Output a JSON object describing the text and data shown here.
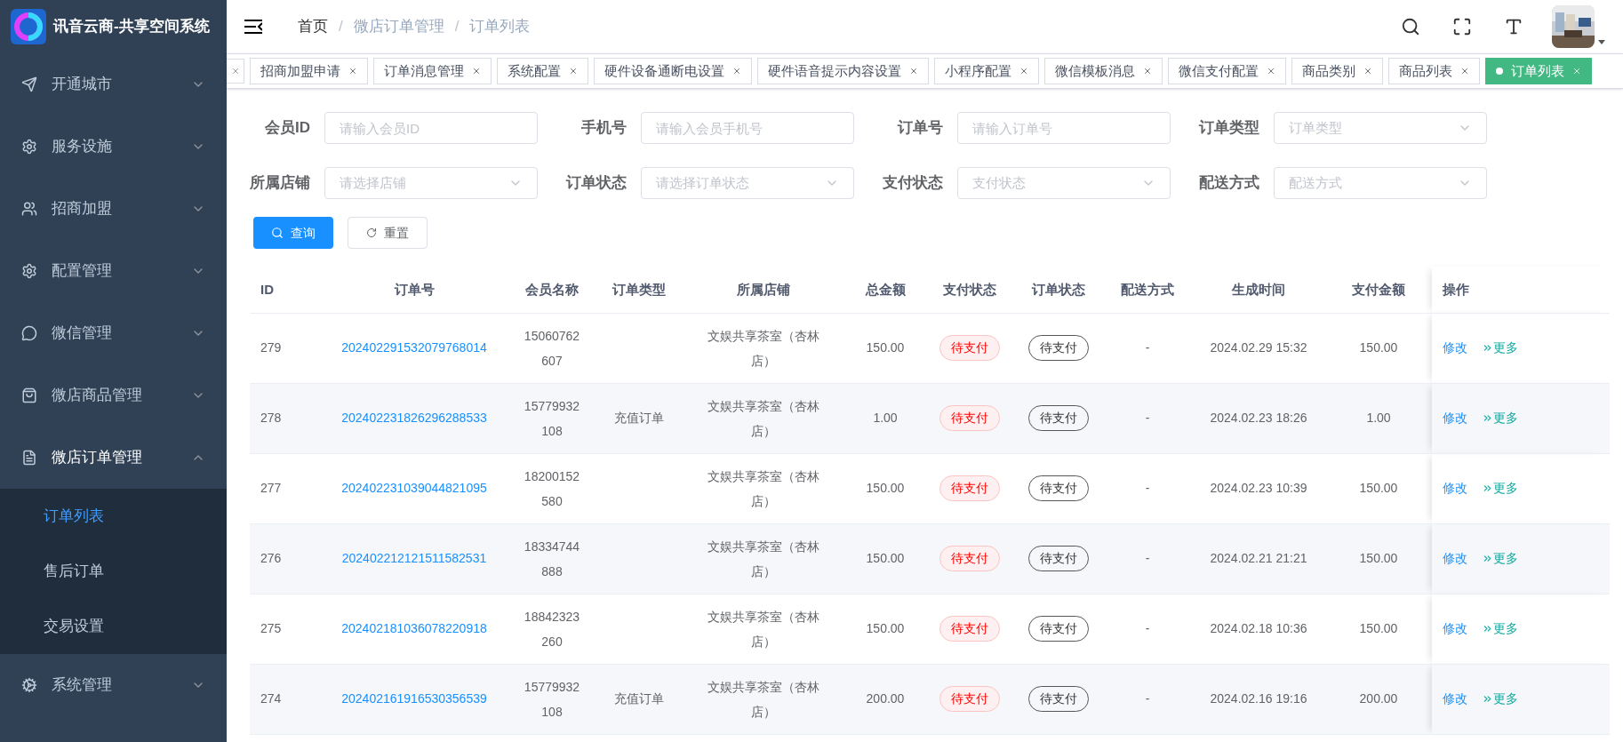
{
  "logo": {
    "title": "讯音云商-共享空间系统"
  },
  "sidebar": {
    "items": [
      {
        "label": "开通城市",
        "expanded": false
      },
      {
        "label": "服务设施",
        "expanded": false
      },
      {
        "label": "招商加盟",
        "expanded": false
      },
      {
        "label": "配置管理",
        "expanded": false
      },
      {
        "label": "微信管理",
        "expanded": false
      },
      {
        "label": "微店商品管理",
        "expanded": false
      },
      {
        "label": "微店订单管理",
        "expanded": true,
        "children": [
          {
            "label": "订单列表",
            "selected": true
          },
          {
            "label": "售后订单",
            "selected": false
          },
          {
            "label": "交易设置",
            "selected": false
          }
        ]
      },
      {
        "label": "系统管理",
        "expanded": false
      }
    ]
  },
  "breadcrumb": {
    "separator": "/",
    "items": [
      "首页",
      "微店订单管理",
      "订单列表"
    ]
  },
  "tabs": [
    {
      "kind": "clipped"
    },
    {
      "kind": "tab",
      "label": "招商加盟申请",
      "selected": false
    },
    {
      "kind": "tab",
      "label": "订单消息管理",
      "selected": false
    },
    {
      "kind": "tab",
      "label": "系统配置",
      "selected": false
    },
    {
      "kind": "tab",
      "label": "硬件设备通断电设置",
      "selected": false
    },
    {
      "kind": "tab",
      "label": "硬件语音提示内容设置",
      "selected": false
    },
    {
      "kind": "tab",
      "label": "小程序配置",
      "selected": false
    },
    {
      "kind": "tab",
      "label": "微信模板消息",
      "selected": false
    },
    {
      "kind": "tab",
      "label": "微信支付配置",
      "selected": false
    },
    {
      "kind": "tab",
      "label": "商品类别",
      "selected": false
    },
    {
      "kind": "tab",
      "label": "商品列表",
      "selected": false
    },
    {
      "kind": "tab",
      "label": "订单列表",
      "selected": true
    }
  ],
  "filters": [
    {
      "label": "会员ID",
      "kind": "input",
      "placeholder": "请输入会员ID"
    },
    {
      "label": "手机号",
      "kind": "input",
      "placeholder": "请输入会员手机号"
    },
    {
      "label": "订单号",
      "kind": "input",
      "placeholder": "请输入订单号"
    },
    {
      "label": "订单类型",
      "kind": "select",
      "placeholder": "订单类型"
    },
    {
      "label": "所属店铺",
      "kind": "select",
      "placeholder": "请选择店铺"
    },
    {
      "label": "订单状态",
      "kind": "select",
      "placeholder": "请选择订单状态"
    },
    {
      "label": "支付状态",
      "kind": "select",
      "placeholder": "支付状态"
    },
    {
      "label": "配送方式",
      "kind": "select",
      "placeholder": "配送方式"
    }
  ],
  "buttons": {
    "search": "查询",
    "reset": "重置"
  },
  "table": {
    "columns": [
      "ID",
      "订单号",
      "会员名称",
      "订单类型",
      "所属店铺",
      "总金额",
      "支付状态",
      "订单状态",
      "配送方式",
      "生成时间",
      "支付金额",
      "操作"
    ],
    "rows": [
      {
        "id": "279",
        "order_no": "202402291532079768014",
        "member": "15060762607",
        "store": "文娱共享茶室（杏林店）",
        "total": "150.00",
        "pay_status": "待支付",
        "order_status": "待支付",
        "delivery": "-",
        "time": "2024.02.29 15:32",
        "paid": "150.00",
        "edit": "修改",
        "more": "更多"
      },
      {
        "id": "278",
        "order_no": "202402231826296288533",
        "member": "15779932108",
        "type": "充值订单",
        "store": "文娱共享茶室（杏林店）",
        "total": "1.00",
        "pay_status": "待支付",
        "order_status": "待支付",
        "delivery": "-",
        "time": "2024.02.23 18:26",
        "paid": "1.00",
        "edit": "修改",
        "more": "更多"
      },
      {
        "id": "277",
        "order_no": "202402231039044821095",
        "member": "18200152580",
        "store": "文娱共享茶室（杏林店）",
        "total": "150.00",
        "pay_status": "待支付",
        "order_status": "待支付",
        "delivery": "-",
        "time": "2024.02.23 10:39",
        "paid": "150.00",
        "edit": "修改",
        "more": "更多"
      },
      {
        "id": "276",
        "order_no": "202402212121511582531",
        "member": "18334744888",
        "store": "文娱共享茶室（杏林店）",
        "total": "150.00",
        "pay_status": "待支付",
        "order_status": "待支付",
        "delivery": "-",
        "time": "2024.02.21 21:21",
        "paid": "150.00",
        "edit": "修改",
        "more": "更多"
      },
      {
        "id": "275",
        "order_no": "202402181036078220918",
        "member": "18842323260",
        "store": "文娱共享茶室（杏林店）",
        "total": "150.00",
        "pay_status": "待支付",
        "order_status": "待支付",
        "delivery": "-",
        "time": "2024.02.18 10:36",
        "paid": "150.00",
        "edit": "修改",
        "more": "更多"
      },
      {
        "id": "274",
        "order_no": "202402161916530356539",
        "member": "15779932108",
        "type": "充值订单",
        "store": "文娱共享茶室（杏林店）",
        "total": "200.00",
        "pay_status": "待支付",
        "order_status": "待支付",
        "delivery": "-",
        "time": "2024.02.16 19:16",
        "paid": "200.00",
        "edit": "修改",
        "more": "更多"
      }
    ]
  }
}
